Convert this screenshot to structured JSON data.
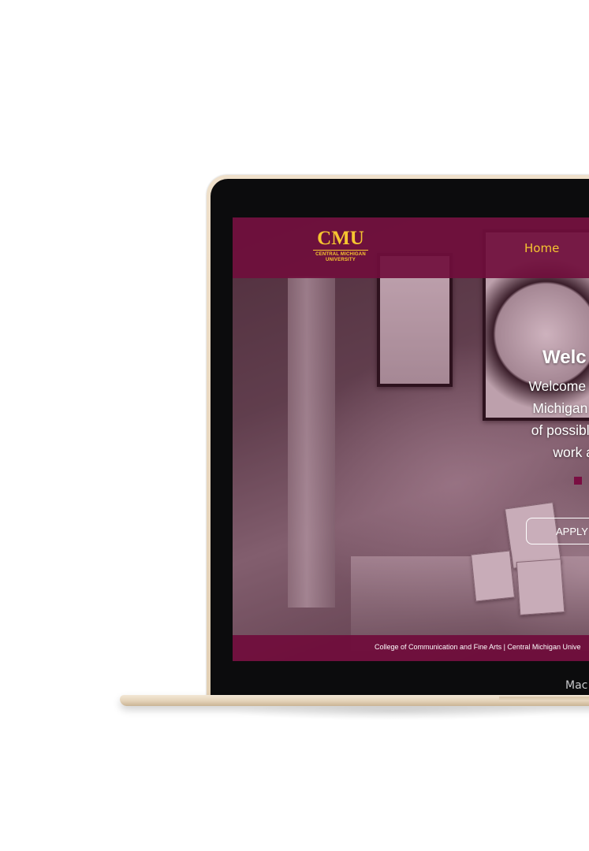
{
  "device": {
    "chin_label": "Mac"
  },
  "site": {
    "logo": {
      "mark": "CMU",
      "subtitle_line1": "CENTRAL MICHIGAN",
      "subtitle_line2": "UNIVERSITY"
    },
    "nav": {
      "home_label": "Home"
    },
    "hero": {
      "title": "Welc",
      "lines": [
        "Welcome to the School of",
        "Michigan University. Our",
        "of possible careers, as w",
        "work and pictures"
      ],
      "apply_label": "APPLY"
    },
    "footer": {
      "text": "College of Communication and Fine Arts | Central Michigan Unive"
    }
  },
  "colors": {
    "maroon": "#700e3c",
    "gold": "#f6c530",
    "laptop_gold": "#e8d6bc"
  }
}
